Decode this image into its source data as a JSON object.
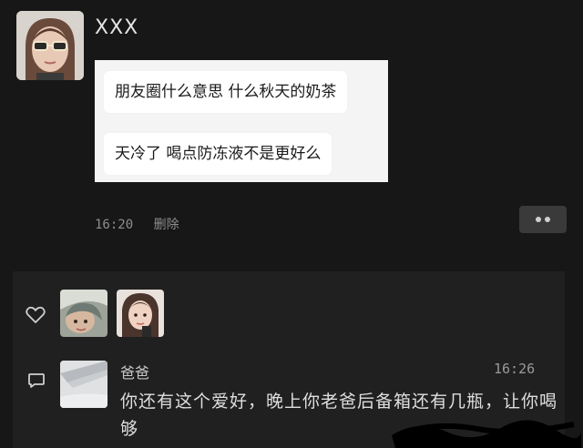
{
  "post": {
    "username": "XXX",
    "messages": [
      "朋友圈什么意思 什么秋天的奶茶",
      "天冷了 喝点防冻液不是更好么"
    ],
    "time": "16:20",
    "delete_label": "删除"
  },
  "interactions": {
    "likes": [
      {
        "avatar_icon": "liker-avatar-1"
      },
      {
        "avatar_icon": "liker-avatar-2"
      }
    ],
    "comment": {
      "name": "爸爸",
      "time": "16:26",
      "text": "你还有这个爱好，晚上你老爸后备箱还有几瓶，让你喝够"
    }
  },
  "colors": {
    "background": "#171717",
    "panel": "#202020",
    "bubble": "#ffffff"
  }
}
